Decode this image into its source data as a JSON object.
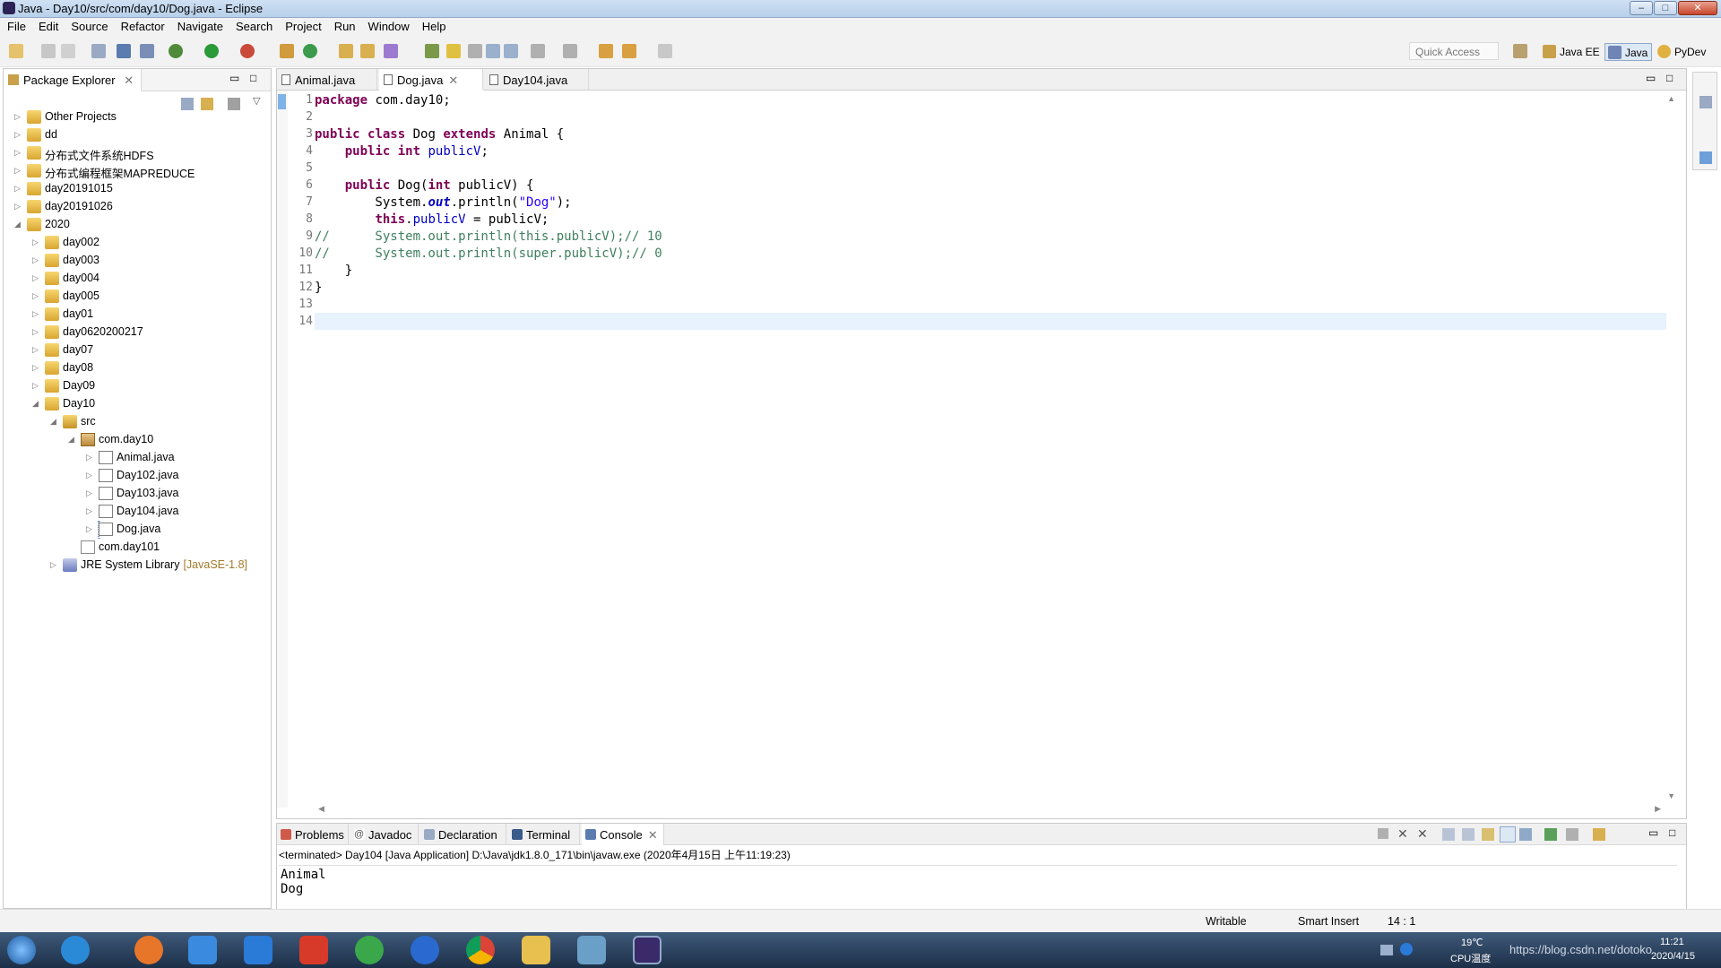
{
  "window": {
    "title": "Java - Day10/src/com/day10/Dog.java - Eclipse",
    "min": "–",
    "max": "□",
    "close": "✕"
  },
  "menu": [
    "File",
    "Edit",
    "Source",
    "Refactor",
    "Navigate",
    "Search",
    "Project",
    "Run",
    "Window",
    "Help"
  ],
  "toolbar": {
    "quick_access_placeholder": "Quick Access",
    "perspectives": [
      "Java EE",
      "Java",
      "PyDev"
    ]
  },
  "package_explorer": {
    "title": "Package Explorer",
    "items": [
      {
        "label": "Other Projects",
        "icon": "project-icon",
        "depth": 0,
        "arrow": "▷"
      },
      {
        "label": "dd",
        "icon": "project-icon",
        "depth": 0,
        "arrow": "▷"
      },
      {
        "label": "分布式文件系统HDFS",
        "icon": "project-icon",
        "depth": 0,
        "arrow": "▷"
      },
      {
        "label": "分布式编程框架MAPREDUCE",
        "icon": "project-icon",
        "depth": 0,
        "arrow": "▷"
      },
      {
        "label": "day20191015",
        "icon": "project-icon",
        "depth": 0,
        "arrow": "▷"
      },
      {
        "label": "day20191026",
        "icon": "project-icon",
        "depth": 0,
        "arrow": "▷"
      },
      {
        "label": "2020",
        "icon": "project-icon",
        "depth": 0,
        "arrow": "◢"
      },
      {
        "label": "day002",
        "icon": "project-icon",
        "depth": 1,
        "arrow": "▷"
      },
      {
        "label": "day003",
        "icon": "project-icon",
        "depth": 1,
        "arrow": "▷"
      },
      {
        "label": "day004",
        "icon": "project-icon",
        "depth": 1,
        "arrow": "▷"
      },
      {
        "label": "day005",
        "icon": "project-icon",
        "depth": 1,
        "arrow": "▷"
      },
      {
        "label": "day01",
        "icon": "project-icon",
        "depth": 1,
        "arrow": "▷"
      },
      {
        "label": "day0620200217",
        "icon": "project-icon",
        "depth": 1,
        "arrow": "▷"
      },
      {
        "label": "day07",
        "icon": "project-icon",
        "depth": 1,
        "arrow": "▷"
      },
      {
        "label": "day08",
        "icon": "project-icon",
        "depth": 1,
        "arrow": "▷"
      },
      {
        "label": "Day09",
        "icon": "project-icon",
        "depth": 1,
        "arrow": "▷"
      },
      {
        "label": "Day10",
        "icon": "project-icon",
        "depth": 1,
        "arrow": "◢"
      },
      {
        "label": "src",
        "icon": "source-folder-icon",
        "depth": 2,
        "arrow": "◢"
      },
      {
        "label": "com.day10",
        "icon": "package-icon",
        "depth": 3,
        "arrow": "◢"
      },
      {
        "label": "Animal.java",
        "icon": "java-file-icon",
        "depth": 4,
        "arrow": "▷"
      },
      {
        "label": "Day102.java",
        "icon": "java-file-icon",
        "depth": 4,
        "arrow": "▷"
      },
      {
        "label": "Day103.java",
        "icon": "java-file-icon",
        "depth": 4,
        "arrow": "▷"
      },
      {
        "label": "Day104.java",
        "icon": "java-file-icon",
        "depth": 4,
        "arrow": "▷"
      },
      {
        "label": "Dog.java",
        "icon": "java-file-icon",
        "depth": 4,
        "arrow": "▷",
        "selected": true
      },
      {
        "label": "com.day101",
        "icon": "empty-package-icon",
        "depth": 3,
        "arrow": ""
      },
      {
        "label": "JRE System Library",
        "suffix": "[JavaSE-1.8]",
        "icon": "library-icon",
        "depth": 2,
        "arrow": "▷"
      }
    ]
  },
  "editor": {
    "tabs": [
      "Animal.java",
      "Dog.java",
      "Day104.java"
    ],
    "active_tab": 1,
    "line_numbers": [
      "1",
      "2",
      "3",
      "4",
      "5",
      "6",
      "7",
      "8",
      "9",
      "10",
      "11",
      "12",
      "13",
      "14"
    ],
    "code": [
      [
        [
          "kw",
          "package"
        ],
        [
          "",
          " com.day10;"
        ]
      ],
      [],
      [
        [
          "kw",
          "public"
        ],
        [
          "",
          " "
        ],
        [
          "kw",
          "class"
        ],
        [
          "",
          " Dog "
        ],
        [
          "kw",
          "extends"
        ],
        [
          "",
          " Animal {"
        ]
      ],
      [
        [
          "",
          " "
        ],
        [
          "kw",
          "   public"
        ],
        [
          "",
          " "
        ],
        [
          "kw",
          "int"
        ],
        [
          "",
          " "
        ],
        [
          "fld",
          "publicV"
        ],
        [
          "",
          ";"
        ]
      ],
      [],
      [
        [
          "",
          "    "
        ],
        [
          "kw",
          "public"
        ],
        [
          "",
          " Dog("
        ],
        [
          "kw",
          "int"
        ],
        [
          "",
          " publicV) {"
        ]
      ],
      [
        [
          "",
          "        System."
        ],
        [
          "sfld",
          "out"
        ],
        [
          "",
          ".println("
        ],
        [
          "str",
          "\"Dog\""
        ],
        [
          "",
          ");"
        ]
      ],
      [
        [
          "",
          "        "
        ],
        [
          "kw",
          "this"
        ],
        [
          "",
          "."
        ],
        [
          "fld",
          "publicV"
        ],
        [
          "",
          " = publicV;"
        ]
      ],
      [
        [
          "cmt",
          "//      System.out.println(this.publicV);// 10"
        ]
      ],
      [
        [
          "cmt",
          "//      System.out.println(super.publicV);// 0"
        ]
      ],
      [
        [
          "",
          "    }"
        ]
      ],
      [
        [
          "",
          "}"
        ]
      ],
      [],
      []
    ]
  },
  "console": {
    "tabs": [
      "Problems",
      "Javadoc",
      "Declaration",
      "Terminal",
      "Console"
    ],
    "status": "<terminated> Day104 [Java Application] D:\\Java\\jdk1.8.0_171\\bin\\javaw.exe (2020年4月15日 上午11:19:23)",
    "output": [
      "Animal",
      "Dog"
    ]
  },
  "statusbar": {
    "writable": "Writable",
    "insert": "Smart Insert",
    "position": "14 : 1"
  },
  "taskbar": {
    "temp": "19℃",
    "cpu": "CPU温度",
    "time": "11:21",
    "date": "2020/4/15",
    "watermark": "https://blog.csdn.net/dotoko"
  }
}
